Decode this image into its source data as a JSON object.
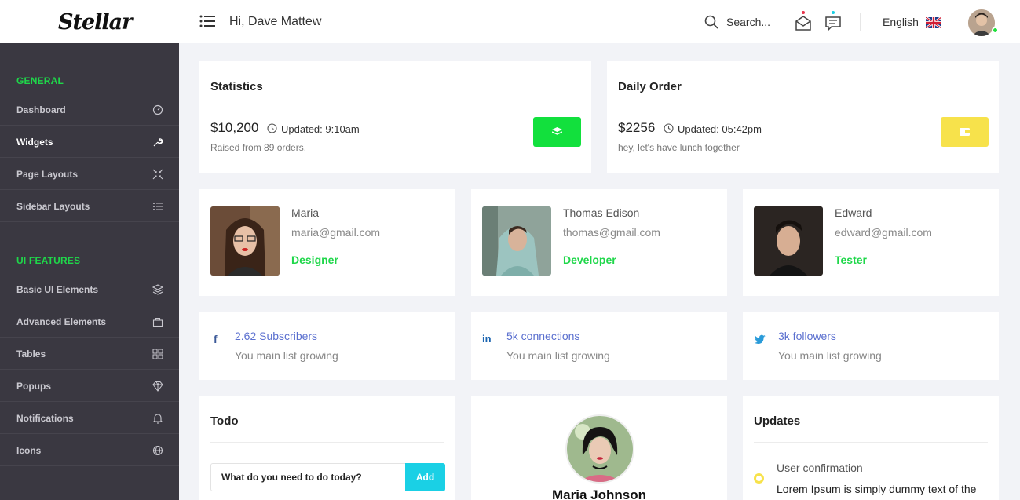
{
  "header": {
    "logo": "Stellar",
    "greeting": "Hi, Dave Mattew",
    "search_label": "Search...",
    "language": "English"
  },
  "sidebar": {
    "sections": [
      {
        "title": "GENERAL",
        "items": [
          {
            "label": "Dashboard",
            "icon": "gauge-icon"
          },
          {
            "label": "Widgets",
            "icon": "wrench-icon"
          },
          {
            "label": "Page Layouts",
            "icon": "shrink-icon"
          },
          {
            "label": "Sidebar Layouts",
            "icon": "list-icon"
          }
        ]
      },
      {
        "title": "UI FEATURES",
        "items": [
          {
            "label": "Basic UI Elements",
            "icon": "layers-icon"
          },
          {
            "label": "Advanced Elements",
            "icon": "briefcase-icon"
          },
          {
            "label": "Tables",
            "icon": "grid-icon"
          },
          {
            "label": "Popups",
            "icon": "diamond-icon"
          },
          {
            "label": "Notifications",
            "icon": "bell-icon"
          },
          {
            "label": "Icons",
            "icon": "globe-icon"
          }
        ]
      }
    ],
    "active_item": "Widgets"
  },
  "statistics": {
    "title": "Statistics",
    "amount": "$10,200",
    "updated": "Updated: 9:10am",
    "subtext": "Raised from 89 orders.",
    "button_color": "#12e03d"
  },
  "daily_order": {
    "title": "Daily Order",
    "amount": "$2256",
    "updated": "Updated: 05:42pm",
    "subtext": "hey, let's have lunch together",
    "button_color": "#f7e24b"
  },
  "people": [
    {
      "name": "Maria",
      "email": "maria@gmail.com",
      "role": "Designer"
    },
    {
      "name": "Thomas Edison",
      "email": "thomas@gmail.com",
      "role": "Developer"
    },
    {
      "name": "Edward",
      "email": "edward@gmail.com",
      "role": "Tester"
    }
  ],
  "social": [
    {
      "icon": "facebook-icon",
      "count": "2.62 Subscribers",
      "sub": "You main list growing"
    },
    {
      "icon": "linkedin-icon",
      "count": "5k connections",
      "sub": "You main list growing"
    },
    {
      "icon": "twitter-icon",
      "count": "3k followers",
      "sub": "You main list growing"
    }
  ],
  "todo": {
    "title": "Todo",
    "input_value": "What do you need to do today?",
    "add_label": "Add"
  },
  "profile": {
    "name": "Maria Johnson"
  },
  "updates": {
    "title": "Updates",
    "item_title": "User confirmation",
    "item_text": "Lorem Ipsum is simply dummy text of the"
  },
  "colors": {
    "accent_green": "#1fd74a",
    "sidebar_bg": "#3a3841",
    "add_button": "#1ad0e5",
    "timeline": "#f7e24b"
  }
}
